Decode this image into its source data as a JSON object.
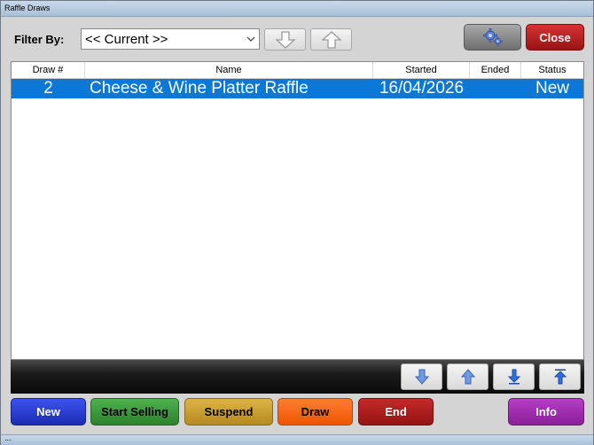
{
  "window": {
    "title": "Raffle Draws"
  },
  "filter": {
    "label": "Filter By:",
    "value": "<< Current >>"
  },
  "header_buttons": {
    "close_label": "Close",
    "settings_icon": "gear-icon"
  },
  "table": {
    "columns": [
      "Draw #",
      "Name",
      "Started",
      "Ended",
      "Status"
    ],
    "rows": [
      {
        "draw": "2",
        "name": "Cheese & Wine Platter Raffle",
        "started": "16/04/2026",
        "ended": "",
        "status": "New"
      }
    ]
  },
  "buttons": {
    "new": "New",
    "start_selling": "Start Selling",
    "suspend": "Suspend",
    "draw": "Draw",
    "end": "End",
    "info": "Info"
  },
  "colors": {
    "selection": "#0b78d7",
    "new": "#2b3fd6",
    "start_selling": "#3a9a3a",
    "suspend": "#c9a032",
    "draw": "#ff6a1a",
    "end": "#b01d1d",
    "info": "#a12fb0",
    "close": "#c42222"
  },
  "status_bar": {
    "text": "..."
  }
}
